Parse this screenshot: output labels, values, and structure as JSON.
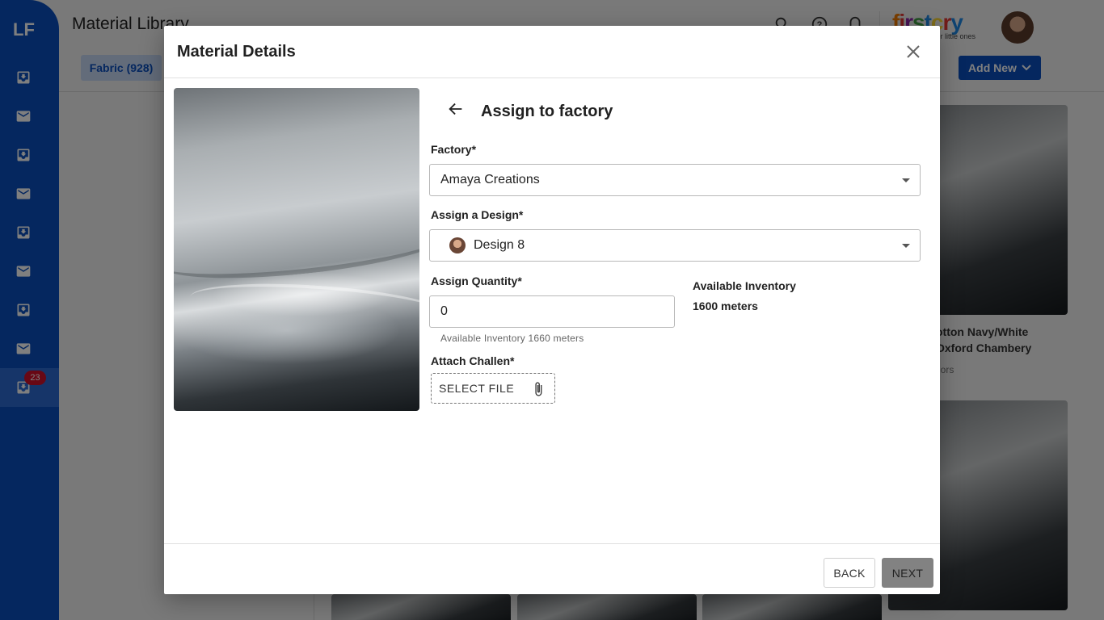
{
  "app": {
    "logo": "LF",
    "title": "Material Library",
    "notification_count": "23",
    "brand_name": "firstcry",
    "brand_tagline": "for little ones",
    "fabric_tab": "Fabric (928)",
    "add_new_label": "Add New",
    "cards": [
      {
        "title_line1": "otton Navy/White",
        "title_line2": "Oxford Chambery",
        "sub": "lors"
      }
    ]
  },
  "modal": {
    "title": "Material Details",
    "section_title": "Assign to factory",
    "factory_label": "Factory*",
    "factory_value": "Amaya Creations",
    "design_label": "Assign a Design*",
    "design_value": "Design 8",
    "quantity_label": "Assign Quantity*",
    "quantity_value": "0",
    "quantity_helper": "Available Inventory 1660 meters",
    "inventory_label": "Available Inventory",
    "inventory_value": "1600 meters",
    "challan_label": "Attach Challen*",
    "select_file_label": "SELECT FILE",
    "back_label": "BACK",
    "next_label": "NEXT"
  }
}
